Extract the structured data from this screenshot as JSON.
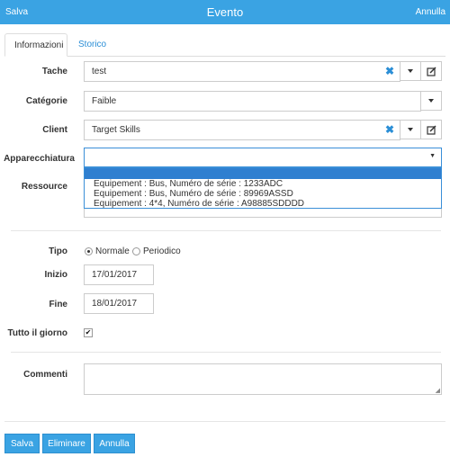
{
  "header": {
    "save": "Salva",
    "title": "Evento",
    "cancel": "Annulla"
  },
  "tabs": [
    {
      "label": "Informazioni"
    },
    {
      "label": "Storico"
    }
  ],
  "fields": {
    "tache": {
      "label": "Tache",
      "value": "test"
    },
    "categorie": {
      "label": "Catégorie",
      "value": "Faible"
    },
    "client": {
      "label": "Client",
      "value": "Target Skills"
    },
    "apparecchiatura": {
      "label": "Apparecchiatura",
      "value": ""
    },
    "ressource": {
      "label": "Ressource"
    },
    "tipo": {
      "label": "Tipo",
      "options": [
        "Normale",
        "Periodico"
      ],
      "selected": "Normale"
    },
    "inizio": {
      "label": "Inizio",
      "value": "17/01/2017"
    },
    "fine": {
      "label": "Fine",
      "value": "18/01/2017"
    },
    "tutto": {
      "label": "Tutto il giorno",
      "checked": true
    },
    "commenti": {
      "label": "Commenti",
      "value": ""
    }
  },
  "dropdown": {
    "options": [
      "Equipement : Bus, Numéro de série : 1233ADC",
      "Equipement : Bus, Numéro de série : 89969ASSD",
      "Equipement : 4*4, Numéro de série : A98885SDDDD"
    ]
  },
  "footer": {
    "save": "Salva",
    "delete": "Eliminare",
    "cancel": "Annulla"
  },
  "colors": {
    "accent": "#3aa3e3",
    "link": "#2a8ed6",
    "highlight": "#2f7fd0"
  }
}
